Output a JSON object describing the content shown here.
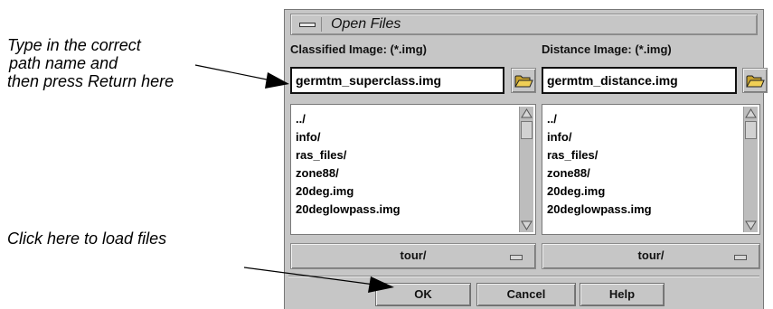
{
  "callouts": {
    "top_lines": [
      "Type in the correct",
      "path name and",
      "then press Return here"
    ],
    "bottom": "Click here to load files"
  },
  "dialog": {
    "title": "Open Files",
    "menu_icon": "window-menu-icon",
    "classified": {
      "label": "Classified Image: (*.img)",
      "path_value": "germtm_superclass.img",
      "folder_icon": "open-folder-icon",
      "files": [
        "../",
        "info/",
        "ras_files/",
        "zone88/",
        "20deg.img",
        "20deglowpass.img"
      ],
      "directory": "tour/"
    },
    "distance": {
      "label": "Distance Image: (*.img)",
      "path_value": "germtm_distance.img",
      "folder_icon": "open-folder-icon",
      "files": [
        "../",
        "info/",
        "ras_files/",
        "zone88/",
        "20deg.img",
        "20deglowpass.img"
      ],
      "directory": "tour/"
    },
    "buttons": {
      "ok": "OK",
      "cancel": "Cancel",
      "help": "Help"
    }
  },
  "colors": {
    "dialog_bg": "#c6c6c6",
    "field_bg": "#ffffff",
    "text": "#111111"
  }
}
